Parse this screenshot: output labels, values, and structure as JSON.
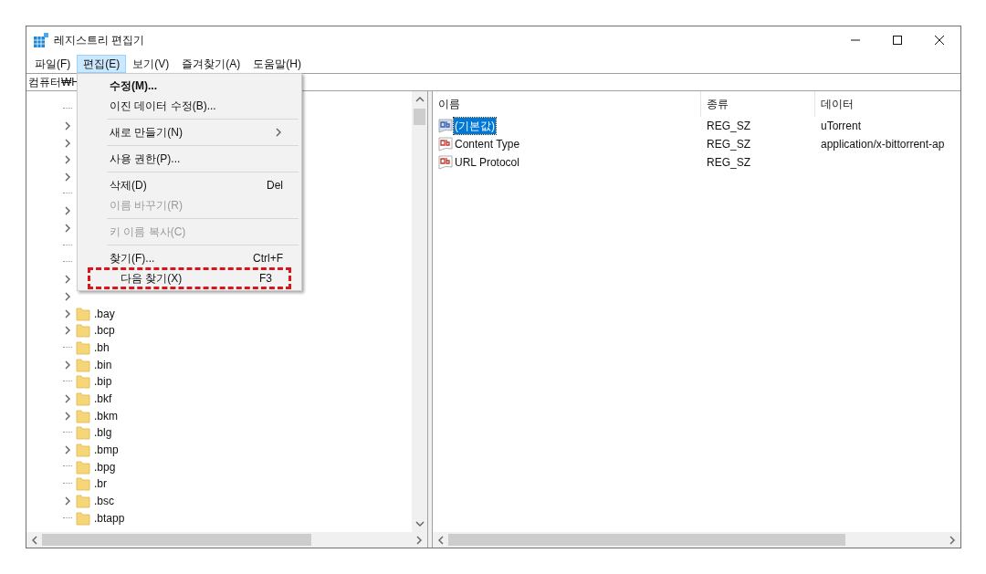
{
  "window": {
    "title": "레지스트리 편집기"
  },
  "menu_bar": [
    {
      "label": "파일(F)",
      "selected": false
    },
    {
      "label": "편집(E)",
      "selected": true
    },
    {
      "label": "보기(V)",
      "selected": false
    },
    {
      "label": "즐겨찾기(A)",
      "selected": false
    },
    {
      "label": "도움말(H)",
      "selected": false
    }
  ],
  "address_bar": {
    "value": "컴퓨터₩H"
  },
  "edit_menu": [
    {
      "label": "수정(M)...",
      "bold": true,
      "disabled": false,
      "annotated": false
    },
    {
      "label": "이진 데이터 수정(B)...",
      "bold": false,
      "disabled": false,
      "annotated": false,
      "separator_after": true
    },
    {
      "label": "새로 만들기(N)",
      "bold": false,
      "disabled": false,
      "annotated": false,
      "submenu": true,
      "separator_after": true
    },
    {
      "label": "사용 권한(P)...",
      "bold": false,
      "disabled": false,
      "annotated": false,
      "separator_after": true
    },
    {
      "label": "삭제(D)",
      "shortcut": "Del",
      "bold": false,
      "disabled": false,
      "annotated": false
    },
    {
      "label": "이름 바꾸기(R)",
      "bold": false,
      "disabled": true,
      "annotated": false,
      "separator_after": true
    },
    {
      "label": "키 이름 복사(C)",
      "bold": false,
      "disabled": true,
      "annotated": false,
      "separator_after": true
    },
    {
      "label": "찾기(F)...",
      "shortcut": "Ctrl+F",
      "bold": false,
      "disabled": false,
      "annotated": false
    },
    {
      "label": "다음 찾기(X)",
      "shortcut": "F3",
      "bold": false,
      "disabled": false,
      "annotated": true
    }
  ],
  "tree": [
    {
      "expandable": false
    },
    {
      "expandable": true
    },
    {
      "expandable": true
    },
    {
      "expandable": true
    },
    {
      "expandable": true
    },
    {
      "expandable": false
    },
    {
      "expandable": true
    },
    {
      "expandable": true
    },
    {
      "expandable": false
    },
    {
      "expandable": false
    },
    {
      "expandable": true
    },
    {
      "expandable": true
    },
    {
      "label": ".bay",
      "expandable": true
    },
    {
      "label": ".bcp",
      "expandable": true
    },
    {
      "label": ".bh",
      "expandable": false
    },
    {
      "label": ".bin",
      "expandable": true
    },
    {
      "label": ".bip",
      "expandable": false
    },
    {
      "label": ".bkf",
      "expandable": true
    },
    {
      "label": ".bkm",
      "expandable": true
    },
    {
      "label": ".blg",
      "expandable": false
    },
    {
      "label": ".bmp",
      "expandable": true
    },
    {
      "label": ".bpg",
      "expandable": false
    },
    {
      "label": ".br",
      "expandable": false
    },
    {
      "label": ".bsc",
      "expandable": true
    },
    {
      "label": ".btapp",
      "expandable": false
    }
  ],
  "values_table": {
    "columns": [
      "이름",
      "종류",
      "데이터"
    ],
    "rows": [
      {
        "name": "(기본값)",
        "type": "REG_SZ",
        "data": "uTorrent",
        "selected": true
      },
      {
        "name": "Content Type",
        "type": "REG_SZ",
        "data": "application/x-bittorrent-ap",
        "selected": false
      },
      {
        "name": "URL Protocol",
        "type": "REG_SZ",
        "selected": false
      }
    ]
  }
}
